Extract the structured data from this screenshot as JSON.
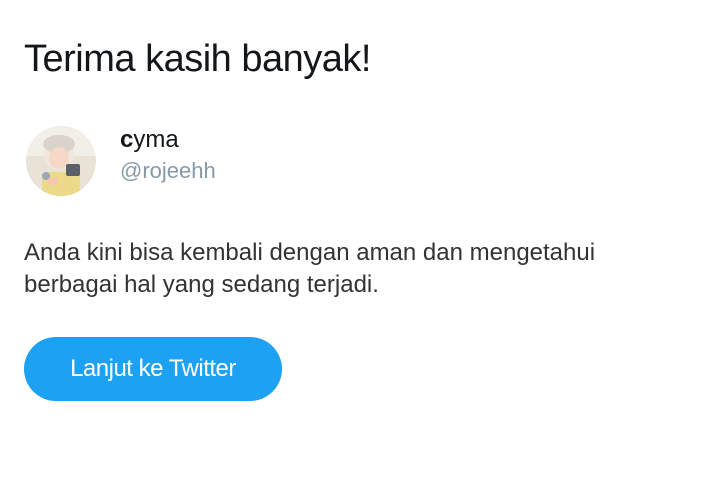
{
  "page": {
    "title": "Terima kasih banyak!",
    "message": "Anda kini bisa kembali dengan aman dan mengetahui berbagai hal yang sedang terjadi."
  },
  "user": {
    "name_first_letter": "c",
    "name_rest": "yma",
    "handle": "@rojeehh",
    "avatar_icon": "user-avatar-photo"
  },
  "actions": {
    "continue_label": "Lanjut ke Twitter"
  },
  "colors": {
    "accent": "#1da1f2",
    "muted_text": "#8899a6",
    "primary_text": "#14171a"
  }
}
